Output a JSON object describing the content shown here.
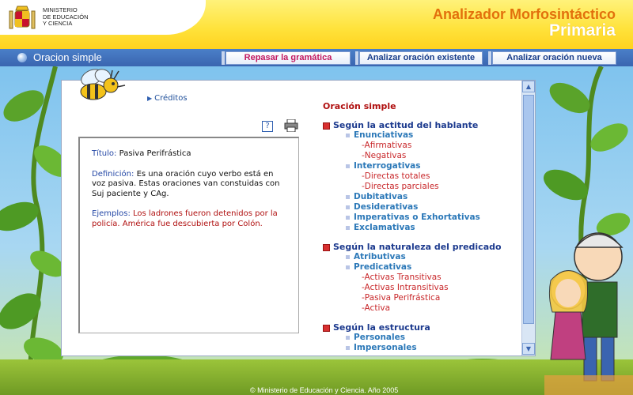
{
  "header": {
    "ministry_lines": [
      "MINISTERIO",
      "DE EDUCACIÓN",
      "Y CIENCIA"
    ],
    "app_title": "Analizador Morfosintáctico",
    "app_subtitle": "Primaria"
  },
  "navbar": {
    "title": "Oracion simple",
    "buttons": [
      {
        "label": "Repasar la gramática"
      },
      {
        "label": "Analizar oración existente"
      },
      {
        "label": "Analizar oración nueva"
      }
    ]
  },
  "content": {
    "credits_label": "Créditos",
    "help_icon": "?",
    "titulo_label": "Título:",
    "titulo_value": "Pasiva Perifrástica",
    "definicion_label": "Definición:",
    "definicion_value": "Es una oración cuyo verbo está en voz pasiva. Estas oraciones van constuidas con Suj paciente y CAg.",
    "ejemplos_label": "Ejemplos:",
    "ejemplos_value": "Los ladrones fueron detenidos por la policía. América fue descubierta por Colón."
  },
  "tree": {
    "title": "Oración simple",
    "sections": [
      {
        "label": "Según la actitud del hablante",
        "items": [
          {
            "label": "Enunciativas",
            "children": [
              "-Afirmativas",
              "-Negativas"
            ]
          },
          {
            "label": "Interrogativas",
            "children": [
              "-Directas totales",
              "-Directas parciales"
            ]
          },
          {
            "label": "Dubitativas",
            "children": []
          },
          {
            "label": "Desiderativas",
            "children": []
          },
          {
            "label": "Imperativas o Exhortativas",
            "children": []
          },
          {
            "label": "Exclamativas",
            "children": []
          }
        ]
      },
      {
        "label": "Según la naturaleza del predicado",
        "items": [
          {
            "label": "Atributivas",
            "children": []
          },
          {
            "label": "Predicativas",
            "children": [
              "-Activas Transitivas",
              "-Activas Intransitivas",
              "-Pasiva Perifrástica",
              "-Activa"
            ]
          }
        ]
      },
      {
        "label": "Según la estructura",
        "items": [
          {
            "label": "Personales",
            "children": []
          },
          {
            "label": "Impersonales",
            "children": []
          }
        ]
      }
    ]
  },
  "footer": {
    "copyright": "© Ministerio de Educación y Ciencia. Año 2005"
  },
  "colors": {
    "header_yellow": "#ffe23a",
    "title_orange": "#e2700c",
    "nav_blue": "#3a65b0",
    "section_red": "#d83030",
    "link_blue": "#2b78b8"
  }
}
